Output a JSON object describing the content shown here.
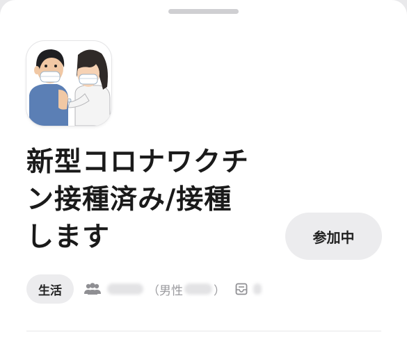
{
  "community": {
    "title_lines": [
      "新型コロナワクチ",
      "ン接種済み/接種",
      "します"
    ],
    "join_button_label": "参加中",
    "category": "生活",
    "members": {
      "open_paren": "（",
      "gender_label": "男性",
      "close_paren": "）"
    }
  },
  "icons": {
    "grab": "drag-handle",
    "avatar": "vaccination-illustration",
    "members": "people-icon",
    "posts": "inbox-icon"
  },
  "colors": {
    "sheet": "#ffffff",
    "chip_background": "#ececee",
    "title": "#1a1a1a",
    "muted_text": "#9a9a9e"
  }
}
